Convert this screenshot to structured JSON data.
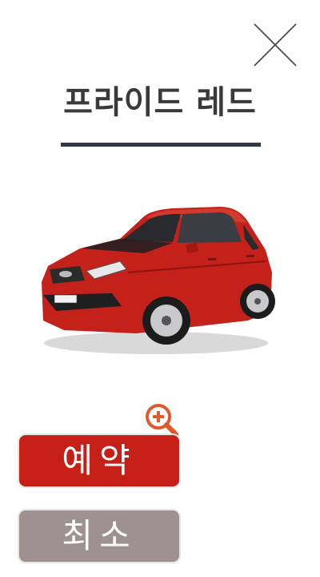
{
  "header": {
    "title": "프라이드 레드"
  },
  "icons": {
    "close": "close-icon",
    "zoom": "zoom-in-icon",
    "car_image": "red-sedan-image"
  },
  "buttons": {
    "reserve_label": "예약",
    "cancel_label": "최소"
  },
  "colors": {
    "reserve": "#c51f17",
    "cancel": "#9d9191",
    "zoom": "#e0582e",
    "underline": "#2f3a44",
    "car_body": "#c4211b"
  }
}
